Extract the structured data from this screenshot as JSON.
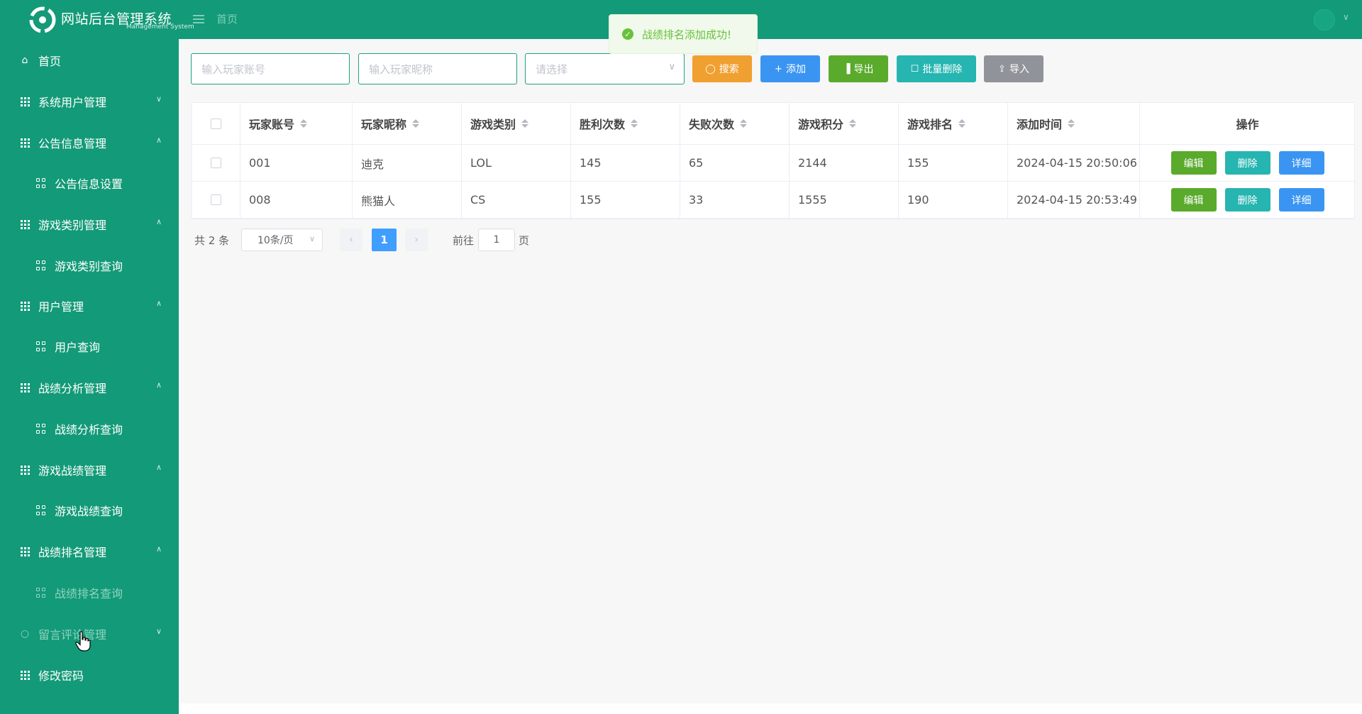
{
  "app": {
    "title": "网站后台管理系统",
    "subtitle": "Management System",
    "breadcrumb": "首页"
  },
  "sidebar": {
    "items": [
      {
        "label": "首页",
        "icon": "home-icon",
        "level": 1,
        "arrow": ""
      },
      {
        "label": "系统用户管理",
        "icon": "grid-icon",
        "level": 1,
        "arrow": "down"
      },
      {
        "label": "公告信息管理",
        "icon": "grid-icon",
        "level": 1,
        "arrow": "up"
      },
      {
        "label": "公告信息设置",
        "icon": "apps-icon",
        "level": 2,
        "arrow": ""
      },
      {
        "label": "游戏类别管理",
        "icon": "grid-icon",
        "level": 1,
        "arrow": "up"
      },
      {
        "label": "游戏类别查询",
        "icon": "apps-icon",
        "level": 2,
        "arrow": ""
      },
      {
        "label": "用户管理",
        "icon": "grid-icon",
        "level": 1,
        "arrow": "up"
      },
      {
        "label": "用户查询",
        "icon": "apps-icon",
        "level": 2,
        "arrow": ""
      },
      {
        "label": "战绩分析管理",
        "icon": "grid-icon",
        "level": 1,
        "arrow": "up"
      },
      {
        "label": "战绩分析查询",
        "icon": "apps-icon",
        "level": 2,
        "arrow": ""
      },
      {
        "label": "游戏战绩管理",
        "icon": "grid-icon",
        "level": 1,
        "arrow": "up"
      },
      {
        "label": "游戏战绩查询",
        "icon": "apps-icon",
        "level": 2,
        "arrow": ""
      },
      {
        "label": "战绩排名管理",
        "icon": "grid-icon",
        "level": 1,
        "arrow": "up"
      },
      {
        "label": "战绩排名查询",
        "icon": "apps-icon",
        "level": 2,
        "arrow": ""
      },
      {
        "label": "留言评论管理",
        "icon": "circle-icon",
        "level": 1,
        "arrow": "down"
      },
      {
        "label": "修改密码",
        "icon": "grid-icon",
        "level": 1,
        "arrow": ""
      }
    ]
  },
  "search": {
    "account_placeholder": "输入玩家账号",
    "nickname_placeholder": "输入玩家昵称",
    "select_placeholder": "请选择"
  },
  "toolbar": {
    "search_label": "搜索",
    "add_label": "添加",
    "export_label": "导出",
    "batch_delete_label": "批量删除",
    "import_label": "导入"
  },
  "table": {
    "columns": [
      "玩家账号",
      "玩家昵称",
      "游戏类别",
      "胜利次数",
      "失败次数",
      "游戏积分",
      "游戏排名",
      "添加时间",
      "操作"
    ],
    "rows": [
      {
        "account": "001",
        "nickname": "迪克",
        "category": "LOL",
        "wins": "145",
        "losses": "65",
        "score": "2144",
        "rank": "155",
        "added": "2024-04-15 20:50:06"
      },
      {
        "account": "008",
        "nickname": "熊猫人",
        "category": "CS",
        "wins": "155",
        "losses": "33",
        "score": "1555",
        "rank": "190",
        "added": "2024-04-15 20:53:49"
      }
    ],
    "actions": {
      "edit": "编辑",
      "delete": "删除",
      "detail": "详细"
    }
  },
  "pagination": {
    "total": "共 2 条",
    "page_size": "10条/页",
    "current_page": "1",
    "goto_label": "前往",
    "goto_value": "1",
    "page_label": "页"
  },
  "toast": {
    "message": "战绩排名添加成功!"
  },
  "colors": {
    "primary_green": "#139a78",
    "search_btn": "#f0a030",
    "add_btn": "#3a95f2",
    "export_btn": "#5aaa2c",
    "batch_delete_btn": "#26b5b0",
    "import_btn": "#909399",
    "edit_btn": "#5aaa2c",
    "delete_btn": "#26b5b0",
    "detail_btn": "#3a95f2"
  }
}
